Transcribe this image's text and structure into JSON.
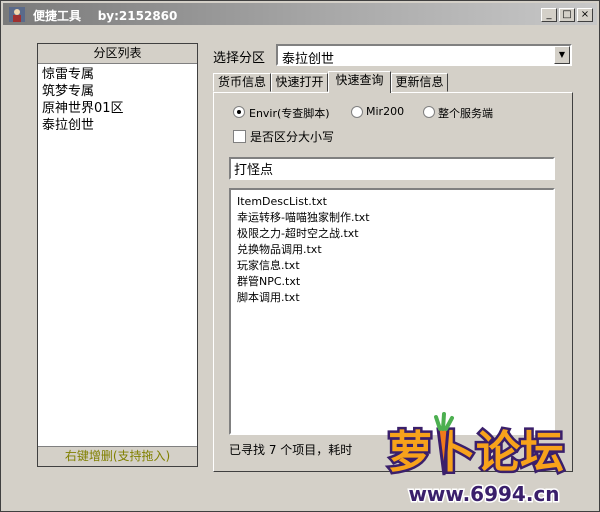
{
  "window": {
    "title": "便捷工具    by:2152860",
    "controls": {
      "minimize": "_",
      "maximize": "□",
      "close": "×"
    }
  },
  "left_panel": {
    "header": "分区列表",
    "items": [
      "惊雷专属",
      "筑梦专属",
      "原神世界01区",
      "泰拉创世"
    ],
    "footer": "右键增删(支持拖入)"
  },
  "zone": {
    "label": "选择分区",
    "selected": "泰拉创世"
  },
  "tabs": [
    {
      "label": "货币信息",
      "active": false
    },
    {
      "label": "快速打开",
      "active": false
    },
    {
      "label": "快速查询",
      "active": true
    },
    {
      "label": "更新信息",
      "active": false
    }
  ],
  "search_options": {
    "radios": [
      {
        "label": "Envir(专查脚本)",
        "checked": true
      },
      {
        "label": "Mir200",
        "checked": false
      },
      {
        "label": "整个服务端",
        "checked": false
      }
    ],
    "case_sensitive_label": "是否区分大小写",
    "case_sensitive": false
  },
  "search": {
    "value": "打怪点"
  },
  "results": [
    "ItemDescList.txt",
    "幸运转移-喵喵独家制作.txt",
    "极限之力-超时空之战.txt",
    "兑换物品调用.txt",
    "玩家信息.txt",
    "群管NPC.txt",
    "脚本调用.txt"
  ],
  "status": "已寻找 7 个项目，耗时",
  "watermark": {
    "text": "萝卜论坛",
    "url": "www.6994.cn"
  },
  "colors": {
    "title_gradient_start": "#7a7a7a",
    "footer_text": "#808000",
    "logo_orange": "#f7a21b",
    "logo_purple": "#3a1f6b"
  }
}
